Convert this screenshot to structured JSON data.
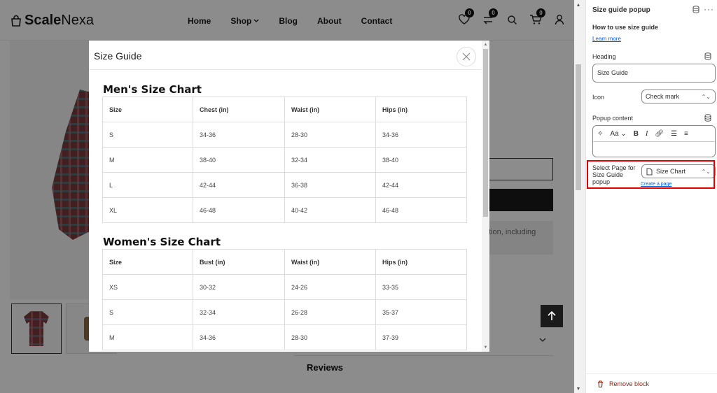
{
  "store": {
    "logo_text_bold": "Scale",
    "logo_text_regular": "Nexa",
    "nav": [
      "Home",
      "Shop",
      "Blog",
      "About",
      "Contact"
    ],
    "wishlist_count": "0",
    "compare_count": "0",
    "cart_count": "0",
    "description_snippet": "tion, including",
    "reviews_label": "Reviews"
  },
  "modal": {
    "title": "Size Guide",
    "men": {
      "heading": "Men's Size Chart",
      "columns": [
        "Size",
        "Chest (in)",
        "Waist (in)",
        "Hips (in)"
      ],
      "rows": [
        [
          "S",
          "34-36",
          "28-30",
          "34-36"
        ],
        [
          "M",
          "38-40",
          "32-34",
          "38-40"
        ],
        [
          "L",
          "42-44",
          "36-38",
          "42-44"
        ],
        [
          "XL",
          "46-48",
          "40-42",
          "46-48"
        ]
      ]
    },
    "women": {
      "heading": "Women's Size Chart",
      "columns": [
        "Size",
        "Bust (in)",
        "Waist (in)",
        "Hips (in)"
      ],
      "rows": [
        [
          "XS",
          "30-32",
          "24-26",
          "33-35"
        ],
        [
          "S",
          "32-34",
          "26-28",
          "35-37"
        ],
        [
          "M",
          "34-36",
          "28-30",
          "37-39"
        ]
      ]
    }
  },
  "panel": {
    "title": "Size guide popup",
    "how_to": "How to use size guide",
    "learn_more": "Learn more",
    "heading_label": "Heading",
    "heading_value": "Size Guide",
    "icon_label": "Icon",
    "icon_value": "Check mark",
    "popup_content_label": "Popup content",
    "rte_font_label": "Aa",
    "select_page_label": "Select Page for Size Guide popup",
    "select_page_value": "Size Chart",
    "create_page": "Create a page",
    "remove_block": "Remove block"
  },
  "colors": {
    "highlight": "#e00000",
    "link": "#005bd3",
    "danger": "#8e1f0b"
  }
}
